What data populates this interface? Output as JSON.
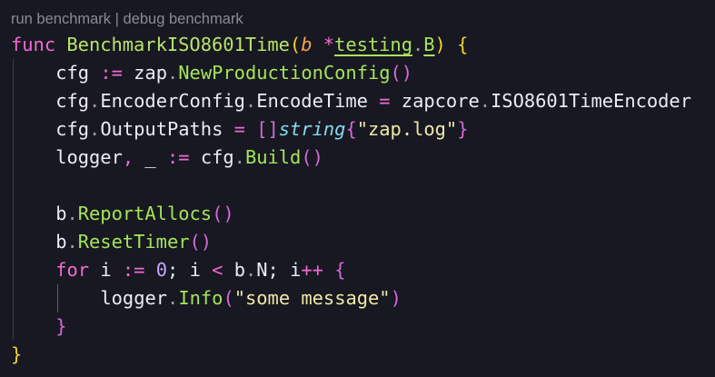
{
  "codelens": {
    "run": "run benchmark",
    "sep": " | ",
    "debug": "debug benchmark"
  },
  "code": {
    "l1": {
      "func": "func",
      "name": "BenchmarkISO8601Time",
      "open_paren": "(",
      "param": "b",
      "star": "*",
      "pkg": "testing",
      "dot": ".",
      "type": "B",
      "close_paren": ")",
      "brace": "{"
    },
    "l2": {
      "var": "cfg",
      "op": ":=",
      "pkg": "zap",
      "dot": ".",
      "call": "NewProductionConfig",
      "parens": "()"
    },
    "l3": {
      "var": "cfg",
      "dot1": ".",
      "field1": "EncoderConfig",
      "dot2": ".",
      "field2": "EncodeTime",
      "op": "=",
      "pkg": "zapcore",
      "dot3": ".",
      "value": "ISO8601TimeEncoder"
    },
    "l4": {
      "var": "cfg",
      "dot": ".",
      "field": "OutputPaths",
      "op": "=",
      "brackets": "[]",
      "type": "string",
      "open": "{",
      "str": "\"zap.log\"",
      "close": "}"
    },
    "l5": {
      "var1": "logger",
      "comma": ",",
      "var2": "_",
      "op": ":=",
      "var3": "cfg",
      "dot": ".",
      "call": "Build",
      "parens": "()"
    },
    "l7": {
      "var": "b",
      "dot": ".",
      "call": "ReportAllocs",
      "parens": "()"
    },
    "l8": {
      "var": "b",
      "dot": ".",
      "call": "ResetTimer",
      "parens": "()"
    },
    "l9": {
      "kw": "for",
      "var": "i",
      "op1": ":=",
      "zero": "0",
      "semi1": ";",
      "var2": "i",
      "op2": "<",
      "obj": "b",
      "dot": ".",
      "field": "N",
      "semi2": ";",
      "var3": "i",
      "op3": "++",
      "brace": "{"
    },
    "l10": {
      "var": "logger",
      "dot": ".",
      "call": "Info",
      "open": "(",
      "str": "\"some message\"",
      "close": ")"
    },
    "l11": {
      "brace": "}"
    },
    "l12": {
      "brace": "}"
    }
  }
}
